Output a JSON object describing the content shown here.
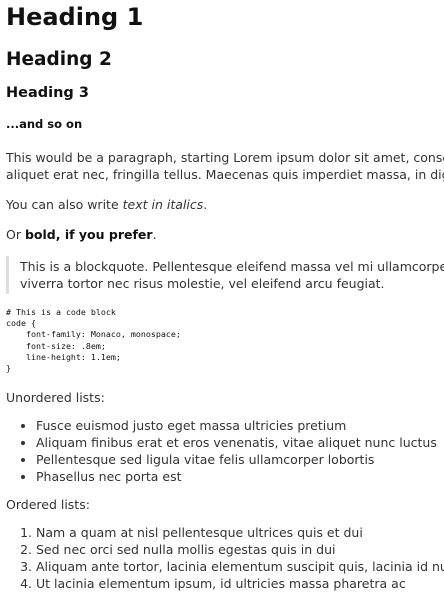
{
  "headings": {
    "h1": "Heading 1",
    "h2": "Heading 2",
    "h3": "Heading 3",
    "h4": "...and so on"
  },
  "paragraph": {
    "line1": "This would be a paragraph, starting Lorem ipsum dolor sit amet, consectetur ac",
    "line2": "aliquet erat nec, fringilla tellus. Maecenas quis imperdiet massa, in dignissim ri"
  },
  "italic_line": {
    "prefix": "You can also write ",
    "italic": "text in italics",
    "suffix": "."
  },
  "bold_line": {
    "prefix": "Or ",
    "bold": "bold, if you prefer",
    "suffix": "."
  },
  "blockquote": {
    "line1": "This is a blockquote. Pellentesque eleifend massa vel mi ullamcorper, a rhon",
    "line2": "viverra tortor nec risus molestie, vel eleifend arcu feugiat."
  },
  "code_block": "# This is a code block\ncode {\n    font-family: Monaco, monospace;\n    font-size: .8em;\n    line-height: 1.1em;\n}",
  "unordered": {
    "label": "Unordered lists:",
    "items": [
      "Fusce euismod justo eget massa ultricies pretium",
      "Aliquam finibus erat et eros venenatis, vitae aliquet nunc luctus",
      "Pellentesque sed ligula vitae felis ullamcorper lobortis",
      "Phasellus nec porta est"
    ]
  },
  "ordered": {
    "label": "Ordered lists:",
    "items": [
      "Nam a quam at nisl pellentesque ultrices quis et dui",
      "Sed nec orci sed nulla mollis egestas quis in dui",
      "Aliquam ante tortor, lacinia elementum suscipit quis, lacinia id nunc",
      "Ut lacinia elementum ipsum, id ultricies massa pharetra ac"
    ]
  }
}
